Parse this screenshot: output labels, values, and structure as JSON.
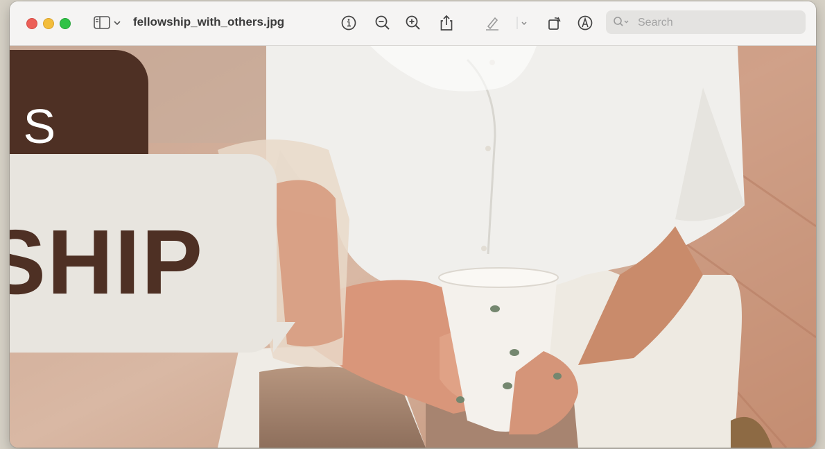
{
  "window": {
    "title": "fellowship_with_others.jpg"
  },
  "toolbar": {
    "traffic_lights": [
      "close",
      "minimize",
      "zoom"
    ],
    "icons": [
      "sidebar-icon",
      "chevron-down-icon",
      "info-icon",
      "zoom-out-icon",
      "zoom-in-icon",
      "share-icon",
      "highlight-icon",
      "chevron-down-icon",
      "rotate-icon",
      "markup-icon"
    ],
    "search": {
      "placeholder": "Search",
      "value": ""
    }
  },
  "image": {
    "overlay_top_text": "IS",
    "overlay_bottom_text": "SHIP"
  },
  "colors": {
    "brand_dark": "#4e3024",
    "overlay_light": "#e8e5df",
    "close": "#ec5f57",
    "minimize": "#f3bd3b",
    "zoom": "#2fc246"
  }
}
